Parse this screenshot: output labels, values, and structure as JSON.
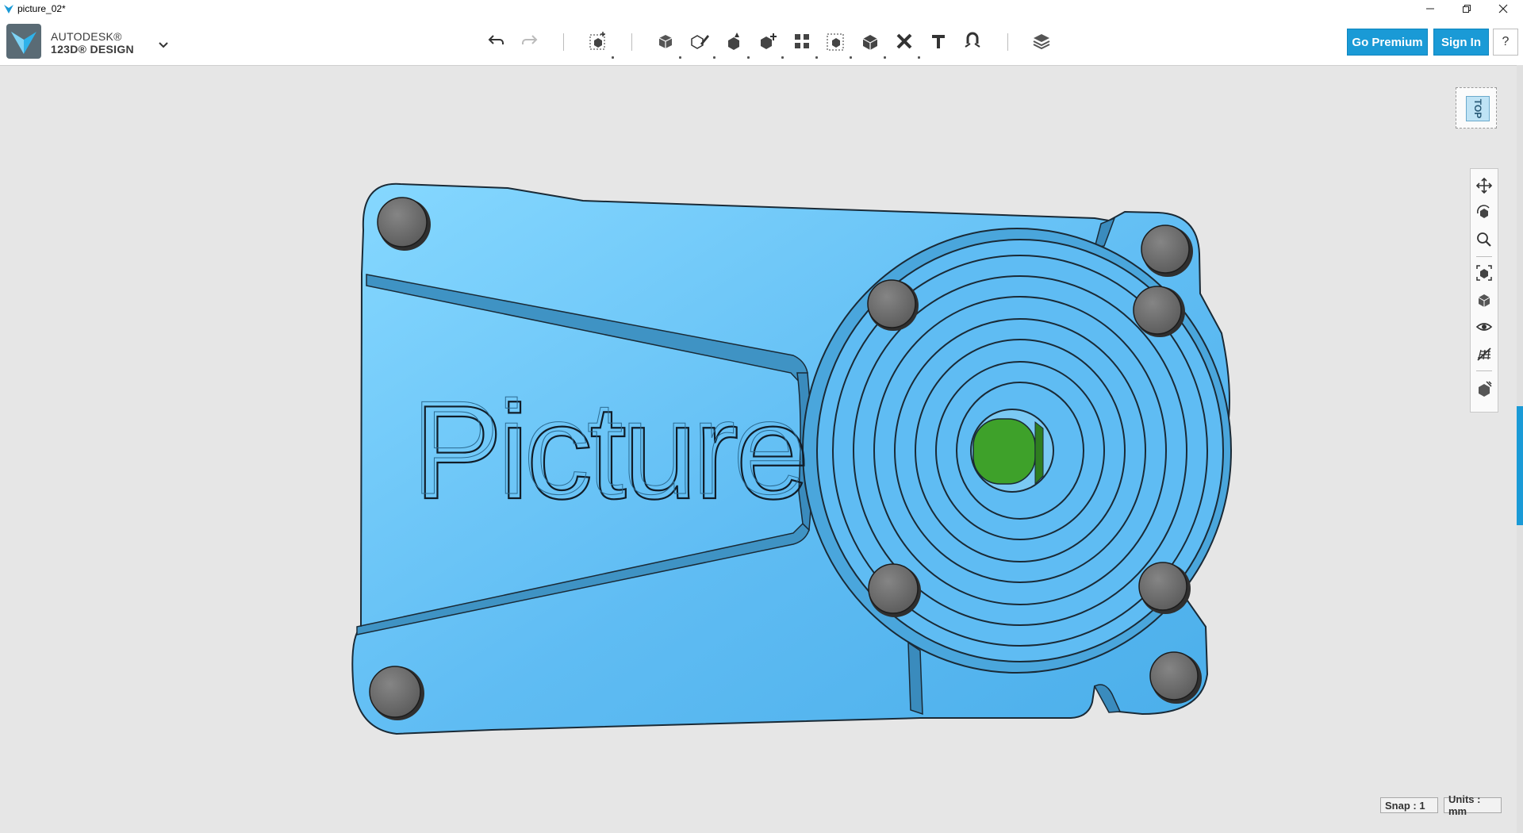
{
  "window": {
    "title": "picture_02*",
    "controls": [
      "minimize-icon",
      "restore-icon",
      "close-icon"
    ]
  },
  "app": {
    "brand_line1": "AUTODESK®",
    "brand_line2": "123D® DESIGN"
  },
  "toolbar": {
    "tools": [
      "undo",
      "redo",
      "transform",
      "primitives",
      "sketch",
      "construct",
      "modify",
      "pattern",
      "grouping",
      "combine",
      "delete",
      "text",
      "snap",
      "materials"
    ]
  },
  "account": {
    "premium_label": "Go Premium",
    "signin_label": "Sign In",
    "help_label": "?"
  },
  "viewcube": {
    "face_label": "TOP"
  },
  "model": {
    "embossed_text": "Picture"
  },
  "status": {
    "snap_label": "Snap : 1",
    "units_label": "Units : mm"
  },
  "colors": {
    "accent": "#1a9ad6",
    "part": "#63bff2",
    "bolt": "#6e6e6e",
    "center_square": "#3ea12a"
  }
}
